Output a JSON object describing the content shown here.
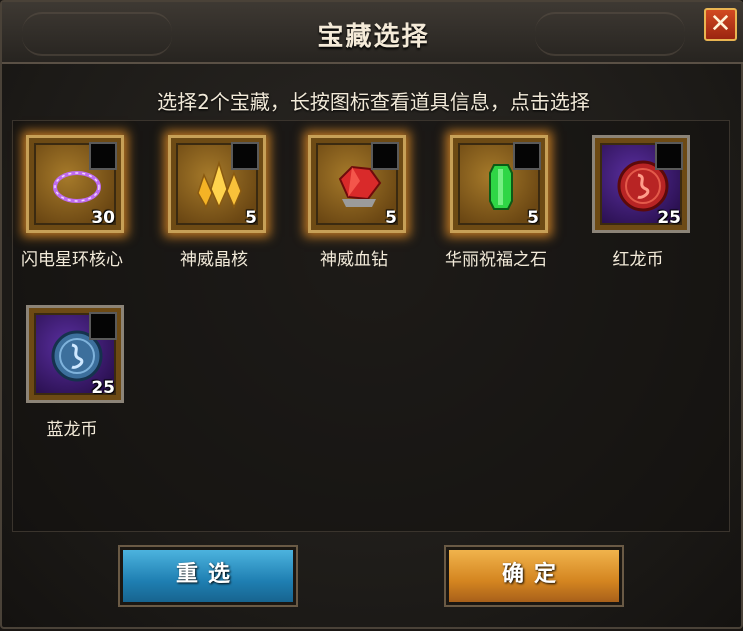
{
  "window": {
    "title": "宝藏选择",
    "close_icon": "close-x-icon"
  },
  "instructions": "选择2个宝藏，长按图标查看道具信息，点击选择",
  "items": [
    {
      "name": "闪电星环核心",
      "count": "30",
      "icon": "lightning-ring-icon",
      "highlighted": true
    },
    {
      "name": "神威晶核",
      "count": "5",
      "icon": "gold-crystal-icon",
      "highlighted": true
    },
    {
      "name": "神威血钻",
      "count": "5",
      "icon": "red-diamond-icon",
      "highlighted": true
    },
    {
      "name": "华丽祝福之石",
      "count": "5",
      "icon": "green-crystal-icon",
      "highlighted": true
    },
    {
      "name": "红龙币",
      "count": "25",
      "icon": "red-dragon-coin-icon",
      "highlighted": false
    },
    {
      "name": "蓝龙币",
      "count": "25",
      "icon": "blue-dragon-coin-icon",
      "highlighted": false
    }
  ],
  "buttons": {
    "reset": "重选",
    "confirm": "确定"
  },
  "colors": {
    "highlight_glow": "#f0962a",
    "reset_button": "#2f97c8",
    "confirm_button": "#e39a32"
  }
}
